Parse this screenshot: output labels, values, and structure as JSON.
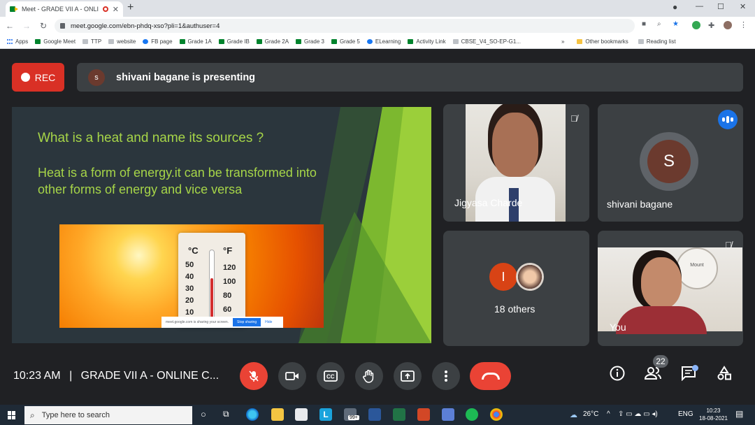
{
  "browser": {
    "tab_title": "Meet - GRADE VII A - ONLIN",
    "tab_close": "✕",
    "new_tab": "+",
    "url": "meet.google.com/ebn-phdq-xso?pli=1&authuser=4",
    "window_controls": {
      "minimize": "—",
      "maximize": "☐",
      "close": "✕"
    }
  },
  "bookmarks": [
    {
      "label": "Apps",
      "icon": "apps-grid-icon"
    },
    {
      "label": "Google Meet",
      "icon": "meet-icon"
    },
    {
      "label": "TTP",
      "icon": "page-icon"
    },
    {
      "label": "website",
      "icon": "page-icon"
    },
    {
      "label": "FB page",
      "icon": "facebook-icon"
    },
    {
      "label": "Grade 1A",
      "icon": "meet-icon"
    },
    {
      "label": "Grade IB",
      "icon": "meet-icon"
    },
    {
      "label": "Grade 2A",
      "icon": "meet-icon"
    },
    {
      "label": "Grade 3",
      "icon": "meet-icon"
    },
    {
      "label": "Grade 5",
      "icon": "meet-icon"
    },
    {
      "label": "ELearning",
      "icon": "page-icon"
    },
    {
      "label": "Activity Link",
      "icon": "meet-icon"
    },
    {
      "label": "CBSE_V4_SO-EP-G1...",
      "icon": "drive-icon"
    }
  ],
  "bookmarks_more": "»",
  "other_bookmarks": "Other bookmarks",
  "reading_list": "Reading list",
  "meet": {
    "rec_label": "REC",
    "presenter_initial": "s",
    "presenting_text": "shivani bagane is presenting",
    "slide": {
      "question": "What is a heat and name its sources ?",
      "answer": "Heat is a form of energy.it can be transformed into other forms of energy and vice versa",
      "thermo_c": "°C",
      "thermo_f": "°F",
      "c_ticks": [
        "50",
        "40",
        "30",
        "20",
        "10"
      ],
      "f_ticks": [
        "120",
        "100",
        "80",
        "60"
      ],
      "share_text": "meet.google.com is sharing your screen.",
      "stop_sharing": "Stop sharing",
      "hide": "Hide"
    },
    "tiles": {
      "jigyasa": {
        "name": "Jigyasa Charde"
      },
      "shivani": {
        "name": "shivani bagane",
        "initial": "S"
      },
      "others": {
        "label": "18 others",
        "initial": "I"
      },
      "you": {
        "name": "You",
        "clock_text": "Mount"
      }
    },
    "time": "10:23 AM",
    "meeting_name": "GRADE VII A - ONLINE C...",
    "separator": "|",
    "participant_count": "22"
  },
  "taskbar": {
    "search_placeholder": "Type here to search",
    "mail_badge": "99+",
    "weather": "26°C",
    "language": "ENG",
    "time": "10:23",
    "date": "18-08-2021"
  },
  "colors": {
    "rec_red": "#d93025",
    "end_call_red": "#ea4335",
    "slide_green": "#a6d548",
    "meet_bg": "#202124"
  }
}
